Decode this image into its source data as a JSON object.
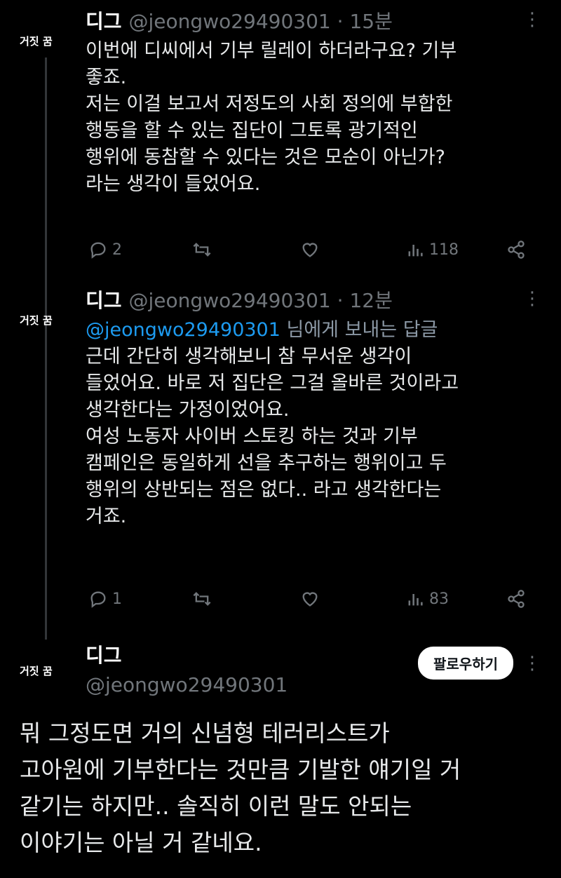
{
  "tweets": [
    {
      "avatar_label": "거짓 꿈",
      "name": "디그",
      "handle": "@jeongwo29490301",
      "dot": "·",
      "time": "15분",
      "lines": [
        "이번에 디씨에서 기부 릴레이 하더라구요? 기부",
        "좋죠.",
        "저는 이걸 보고서 저정도의 사회 정의에 부합한",
        "행동을 할 수 있는 집단이 그토록 광기적인",
        "행위에 동참할 수 있다는 것은 모순이 아닌가?",
        "라는 생각이 들었어요."
      ],
      "replies": "2",
      "views": "118"
    },
    {
      "avatar_label": "거짓 꿈",
      "name": "디그",
      "handle": "@jeongwo29490301",
      "dot": "·",
      "time": "12분",
      "reply_to_handle": "@jeongwo29490301",
      "reply_to_suffix": " 님에게 보내는 답글",
      "lines": [
        "근데 간단히 생각해보니 참 무서운 생각이",
        "들었어요. 바로 저 집단은 그걸 올바른 것이라고",
        "생각한다는 가정이었어요.",
        "여성 노동자 사이버 스토킹 하는 것과 기부",
        "캠페인은 동일하게 선을 추구하는 행위이고 두",
        "행위의 상반되는 점은 없다.. 라고 생각한다는",
        "거죠."
      ],
      "replies": "1",
      "views": "83"
    },
    {
      "avatar_label": "거짓 꿈",
      "name": "디그",
      "handle": "@jeongwo29490301",
      "follow_label": "팔로우하기",
      "lines": [
        "뭐 그정도면 거의 신념형 테러리스트가",
        "고아원에 기부한다는 것만큼 기발한 얘기일 거",
        "같기는 하지만.. 솔직히 이런 말도 안되는",
        "이야기는 아닐 거 같네요."
      ]
    }
  ],
  "icons": {
    "reply": "reply-icon",
    "retweet": "retweet-icon",
    "like": "heart-icon",
    "views": "views-icon",
    "share": "share-icon",
    "more": "more-icon"
  },
  "colors": {
    "background": "#000000",
    "text": "#e7e9ea",
    "muted": "#71767b",
    "link": "#1d9bf0",
    "thread_line": "#333639"
  }
}
